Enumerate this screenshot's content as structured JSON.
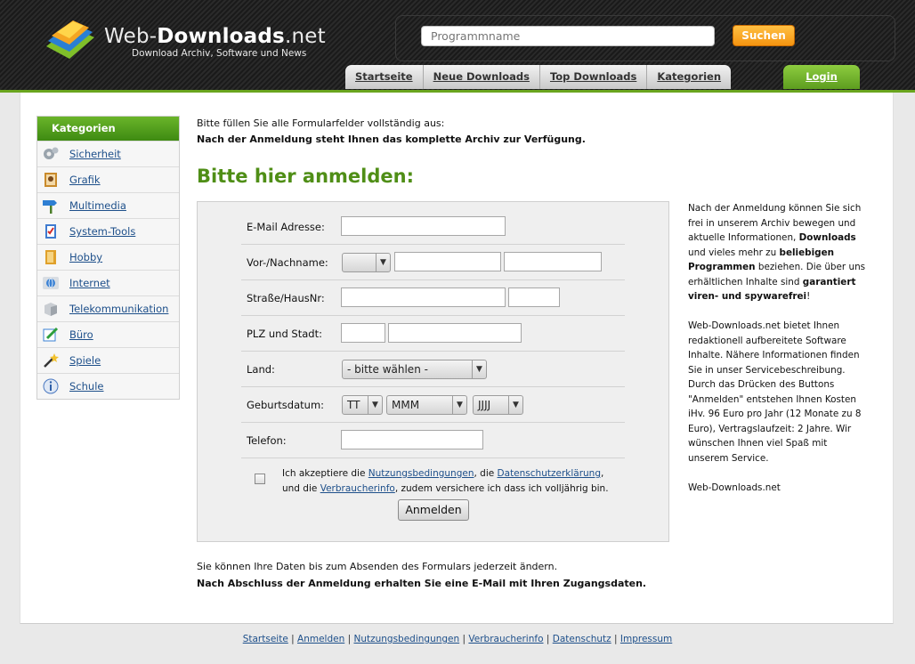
{
  "brand": {
    "name_light": "Web-",
    "name_bold": "Downloads",
    "name_suffix": ".net",
    "tagline": "Download Archiv, Software und News"
  },
  "search": {
    "placeholder": "Programmname",
    "button": "Suchen"
  },
  "nav": {
    "items": [
      "Startseite",
      "Neue Downloads",
      "Top Downloads",
      "Kategorien"
    ],
    "login": "Login"
  },
  "sidebar": {
    "title": "Kategorien",
    "items": [
      {
        "label": "Sicherheit",
        "icon": "gears-icon"
      },
      {
        "label": "Grafik",
        "icon": "picture-icon"
      },
      {
        "label": "Multimedia",
        "icon": "signpost-icon"
      },
      {
        "label": "System-Tools",
        "icon": "checklist-icon"
      },
      {
        "label": "Hobby",
        "icon": "book-icon"
      },
      {
        "label": "Internet",
        "icon": "globe-icon"
      },
      {
        "label": "Telekommunikation",
        "icon": "box-icon"
      },
      {
        "label": "Büro",
        "icon": "pencil-icon"
      },
      {
        "label": "Spiele",
        "icon": "wand-icon"
      },
      {
        "label": "Schule",
        "icon": "info-icon"
      }
    ]
  },
  "intro": {
    "line1": "Bitte füllen Sie alle Formularfelder vollständig aus:",
    "line2": "Nach der Anmeldung steht Ihnen das komplette Archiv zur Verfügung."
  },
  "form": {
    "headline": "Bitte hier anmelden:",
    "labels": {
      "email": "E-Mail Adresse:",
      "name": "Vor-/Nachname:",
      "street": "Straße/HausNr:",
      "city": "PLZ und Stadt:",
      "country": "Land:",
      "birth": "Geburtsdatum:",
      "phone": "Telefon:"
    },
    "country_select": "- bitte wählen -",
    "day_select": "TT",
    "month_select": "MMM",
    "year_select": "JJJJ",
    "agree_line1_a": "Ich akzeptiere die ",
    "agree_link_terms": "Nutzungsbedingungen",
    "agree_line1_b": ", die ",
    "agree_link_privacy": "Datenschutzerklärung",
    "agree_line1_c": ",",
    "agree_line2_a": "und die ",
    "agree_link_consumer": "Verbraucherinfo",
    "agree_line2_b": ", zudem versichere ich dass ich volljährig bin.",
    "submit": "Anmelden"
  },
  "side_info": {
    "p1_a": "Nach der Anmeldung können Sie sich frei in unserem Archiv bewegen und aktuelle Informationen, ",
    "p1_b1": "Downloads",
    "p1_c": " und vieles mehr zu ",
    "p1_b2": "beliebigen Programmen",
    "p1_d": " beziehen. Die über uns erhältlichen Inhalte sind ",
    "p1_b3": "garantiert viren- und spywarefrei",
    "p1_e": "!",
    "p2": "Web-Downloads.net bietet Ihnen redaktionell aufbereitete Software Inhalte. Nähere Informationen finden Sie in unser Servicebeschreibung. Durch das Drücken des Buttons \"Anmelden\" entstehen Ihnen Kosten iHv. 96 Euro pro Jahr (12 Monate zu 8 Euro), Vertragslaufzeit: 2 Jahre. Wir wünschen Ihnen viel Spaß mit unserem Service.",
    "p3": "Web-Downloads.net"
  },
  "bottom": {
    "line1": "Sie können Ihre Daten bis zum Absenden des Formulars jederzeit ändern.",
    "line2": "Nach Abschluss der Anmeldung erhalten Sie eine E-Mail mit Ihren Zugangsdaten."
  },
  "footer": {
    "links": [
      "Startseite",
      "Anmelden",
      "Nutzungsbedingungen",
      "Verbraucherinfo",
      "Datenschutz",
      "Impressum"
    ],
    "separator": " | "
  },
  "colors": {
    "accent_green": "#4f8e16",
    "link_blue": "#1d4f8a",
    "search_orange": "#f59410"
  }
}
